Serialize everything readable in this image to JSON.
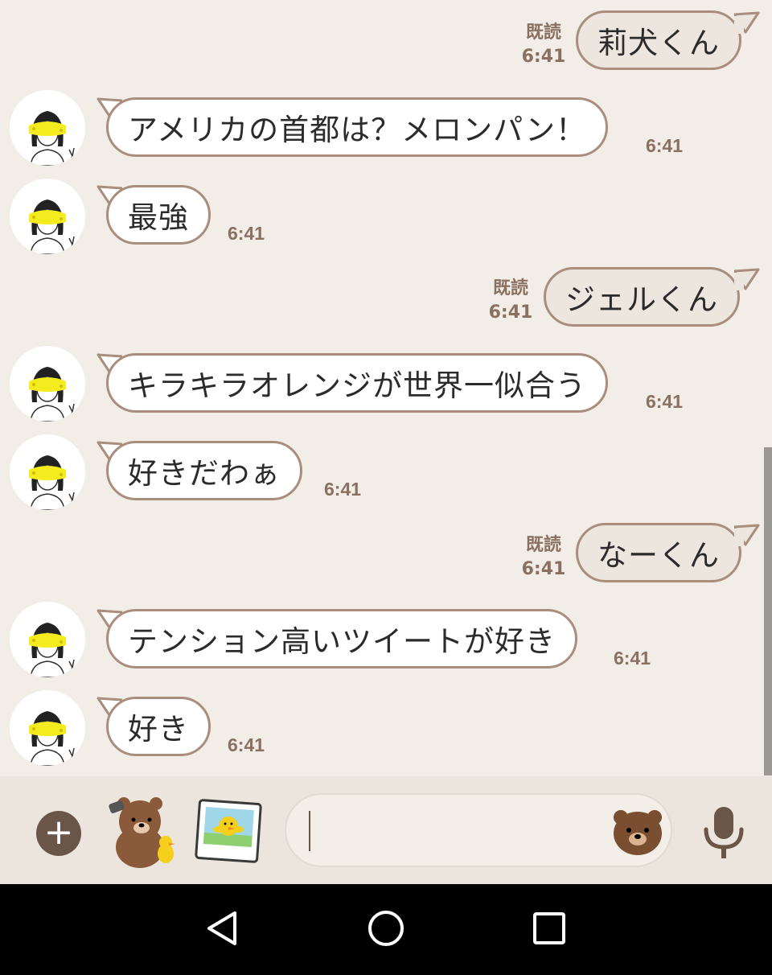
{
  "messages": [
    {
      "dir": "out",
      "text": "莉犬くん",
      "read": "既読",
      "time": "6:41"
    },
    {
      "dir": "in",
      "text": "アメリカの首都は？メロンパン！",
      "time": "6:41"
    },
    {
      "dir": "in",
      "text": "最強",
      "time": "6:41"
    },
    {
      "dir": "out",
      "text": "ジェルくん",
      "read": "既読",
      "time": "6:41"
    },
    {
      "dir": "in",
      "text": "キラキラオレンジが世界一似合う",
      "time": "6:41"
    },
    {
      "dir": "in",
      "text": "好きだわぁ",
      "time": "6:41"
    },
    {
      "dir": "out",
      "text": "なーくん",
      "read": "既読",
      "time": "6:41"
    },
    {
      "dir": "in",
      "text": "テンション高いツイートが好き",
      "time": "6:41"
    },
    {
      "dir": "in",
      "text": "好き",
      "time": "6:41"
    }
  ],
  "input_bar": {
    "plus_icon": "plus-icon",
    "sticker_icon": "bear-sticker-icon",
    "photo_icon": "photo-album-icon",
    "text_value": "",
    "emoji_icon": "bear-emoji-icon",
    "mic_icon": "microphone-icon"
  },
  "nav_bar": {
    "icons": [
      "back-triangle-icon",
      "home-circle-icon",
      "recents-square-icon"
    ]
  },
  "colors": {
    "background": "#f2ede7",
    "bubble_border": "#a98e7e",
    "incoming_bubble": "#ffffff",
    "outgoing_bubble": "#ede6df",
    "meta_text": "#8a7060",
    "highlight_yellow": "#f4ec1e"
  }
}
